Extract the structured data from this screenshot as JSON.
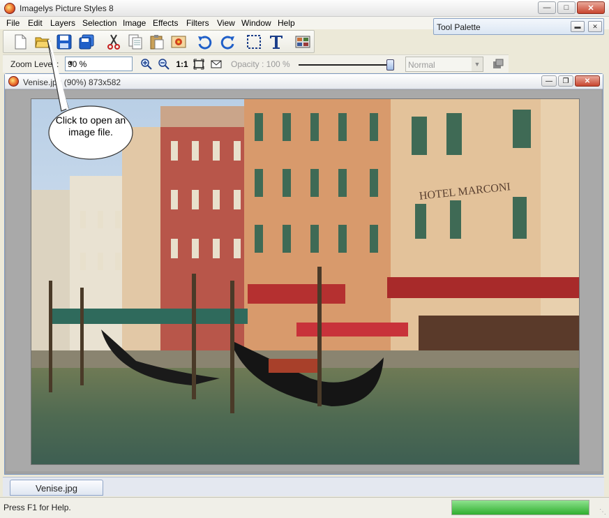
{
  "window": {
    "title": "Imagelys Picture Styles 8",
    "app_icon": "imagelys-logo-icon",
    "controls": [
      "minimize-icon",
      "maximize-icon",
      "close-icon"
    ]
  },
  "menu": {
    "items": [
      "File",
      "Edit",
      "Layers",
      "Selection",
      "Image",
      "Effects",
      "Filters",
      "View",
      "Window",
      "Help"
    ]
  },
  "toolbar": {
    "buttons": [
      "new-file-icon",
      "open-folder-icon",
      "save-icon",
      "save-all-icon",
      "cut-icon",
      "copy-icon",
      "paste-icon",
      "paste-as-layer-icon",
      "undo-icon",
      "redo-icon",
      "rectangle-select-icon",
      "text-tool-icon",
      "gallery-icon"
    ]
  },
  "palette": {
    "title": "Tool Palette",
    "controls": [
      "pin-icon",
      "close-icon"
    ]
  },
  "options": {
    "zoom_label": "Zoom Level :",
    "zoom_value": "90 %",
    "one_to_one": "1:1",
    "opacity_label": "Opacity : 100 %",
    "opacity_level": 1.0,
    "blend_mode": "Normal"
  },
  "document": {
    "title": "Venise.jpg (90%) 873x582",
    "controls": [
      "minimize-icon",
      "restore-icon",
      "close-icon"
    ]
  },
  "callout": {
    "text": "Click to open an image file."
  },
  "tabs": {
    "items": [
      "Venise.jpg"
    ]
  },
  "status": {
    "text": "Press F1 for Help.",
    "progress": 1.0
  },
  "colors": {
    "accent": "#7c98c2",
    "callout_bg": "#ffffff"
  }
}
